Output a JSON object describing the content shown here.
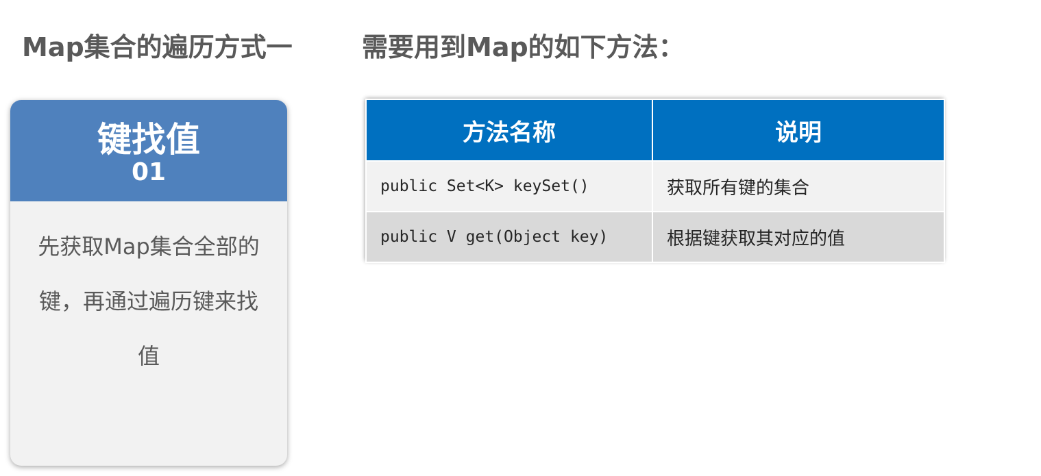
{
  "left_title": "Map集合的遍历方式一",
  "right_title": "需要用到Map的如下方法：",
  "card": {
    "title": "键找值",
    "number": "01",
    "body_lines": [
      "先获取Map集合全部的",
      "键，再通过遍历键来找",
      "值"
    ]
  },
  "table": {
    "headers": [
      "方法名称",
      "说明"
    ],
    "rows": [
      {
        "method": "public Set<K> keySet()",
        "desc": "获取所有键的集合"
      },
      {
        "method": "public V get(Object key)",
        "desc": "根据键获取其对应的值"
      }
    ]
  },
  "colors": {
    "card_header": "#4f81bd",
    "table_header": "#0070c0",
    "title_text": "#595959"
  }
}
